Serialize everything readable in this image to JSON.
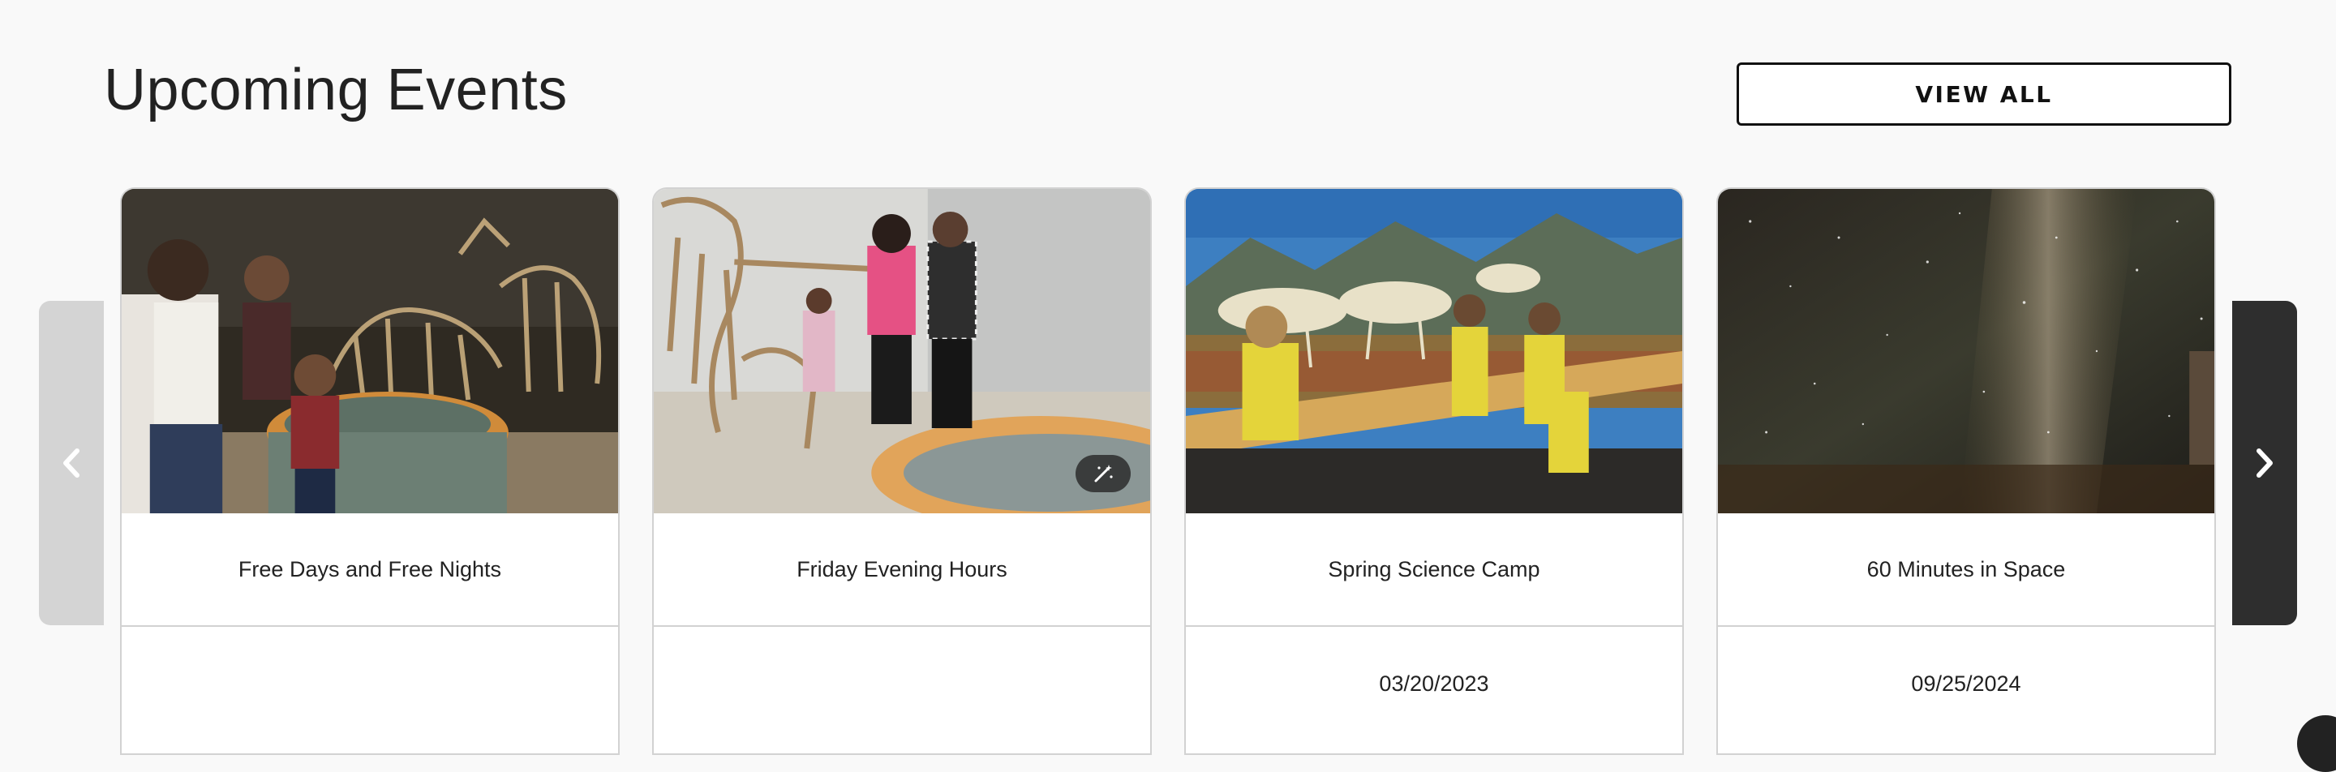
{
  "section": {
    "title": "Upcoming Events",
    "view_all_label": "VIEW ALL"
  },
  "carousel": {
    "prev_icon": "chevron-left-icon",
    "next_icon": "chevron-right-icon",
    "cards": [
      {
        "name": "Free Days and Free Nights",
        "date": "",
        "image": "family viewing dinosaur fossil skeletons"
      },
      {
        "name": "Friday Evening Hours",
        "date": "",
        "image": "visitors at dinosaur skeleton exhibit"
      },
      {
        "name": "Spring Science Camp",
        "date": "03/20/2023",
        "image": "children at caribou diorama"
      },
      {
        "name": "60 Minutes in Space",
        "date": "09/25/2024",
        "image": "milky way night sky"
      }
    ]
  },
  "colors": {
    "background": "#f9f9f9",
    "prev_arrow_bg": "#d4d4d4",
    "next_arrow_bg": "#2e2e2e",
    "button_border": "#111111"
  }
}
